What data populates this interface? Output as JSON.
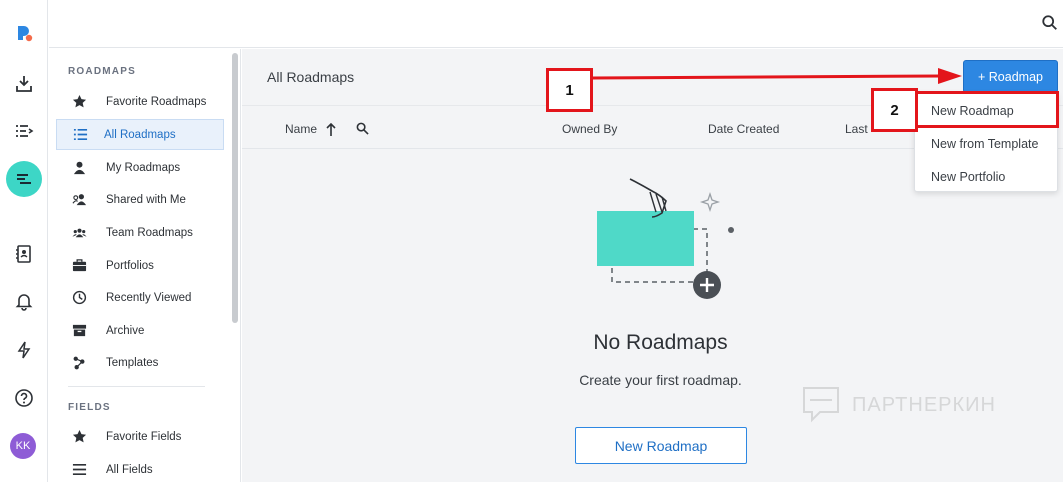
{
  "sidebar": {
    "sections": [
      {
        "label": "ROADMAPS"
      },
      {
        "label": "FIELDS"
      }
    ],
    "items": [
      {
        "label": "Favorite Roadmaps",
        "icon": "star-icon"
      },
      {
        "label": "All Roadmaps",
        "icon": "list-icon",
        "active": true
      },
      {
        "label": "My Roadmaps",
        "icon": "user-icon"
      },
      {
        "label": "Shared with Me",
        "icon": "users-shared-icon"
      },
      {
        "label": "Team Roadmaps",
        "icon": "team-icon"
      },
      {
        "label": "Portfolios",
        "icon": "briefcase-icon"
      },
      {
        "label": "Recently Viewed",
        "icon": "clock-icon"
      },
      {
        "label": "Archive",
        "icon": "archive-icon"
      },
      {
        "label": "Templates",
        "icon": "templates-icon"
      }
    ],
    "field_items": [
      {
        "label": "Favorite Fields",
        "icon": "star-icon"
      },
      {
        "label": "All Fields",
        "icon": "list-icon"
      }
    ]
  },
  "rail": {
    "avatar_initials": "KK"
  },
  "main": {
    "title": "All Roadmaps",
    "add_button": "+ Roadmap",
    "columns": {
      "name": "Name",
      "owned_by": "Owned By",
      "date_created": "Date Created",
      "last": "Last"
    },
    "empty": {
      "title": "No Roadmaps",
      "subtitle": "Create your first roadmap.",
      "button": "New Roadmap"
    }
  },
  "menu": {
    "items": [
      {
        "label": "New Roadmap"
      },
      {
        "label": "New from Template"
      },
      {
        "label": "New Portfolio"
      }
    ]
  },
  "annotations": {
    "step1": "1",
    "step2": "2",
    "color": "#e3151b"
  },
  "watermark": "ПАРТНЕРКИН",
  "colors": {
    "accent": "#2d87e2",
    "rail_active": "#3dd6c6",
    "illustration": "#4fd9c8"
  }
}
